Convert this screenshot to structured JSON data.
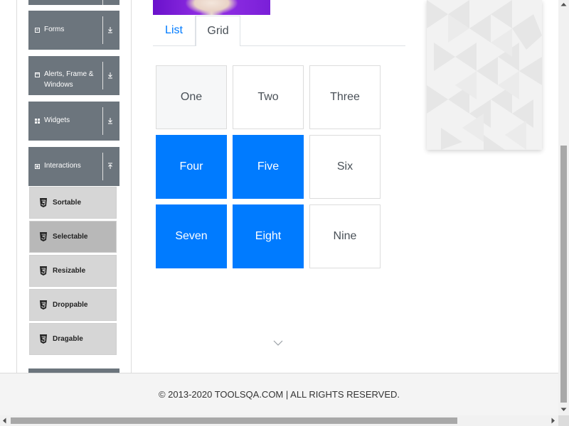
{
  "sidebar": {
    "groups": [
      {
        "label": "Forms",
        "icon": "form-icon"
      },
      {
        "label": "Alerts, Frame &",
        "label2": "Windows",
        "icon": "window-icon"
      },
      {
        "label": "Widgets",
        "icon": "widgets-icon"
      },
      {
        "label": "Interactions",
        "icon": "interactions-icon"
      }
    ],
    "items": [
      {
        "label": "Sortable"
      },
      {
        "label": "Selectable"
      },
      {
        "label": "Resizable"
      },
      {
        "label": "Droppable"
      },
      {
        "label": "Dragable"
      }
    ]
  },
  "tabs": {
    "list": "List",
    "grid": "Grid"
  },
  "grid": {
    "cells": [
      "One",
      "Two",
      "Three",
      "Four",
      "Five",
      "Six",
      "Seven",
      "Eight",
      "Nine"
    ]
  },
  "footer": {
    "text": "© 2013-2020 TOOLSQA.COM | ALL RIGHTS RESERVED."
  },
  "colors": {
    "accent": "#007bff",
    "sidebar_group": "#6c757d"
  }
}
